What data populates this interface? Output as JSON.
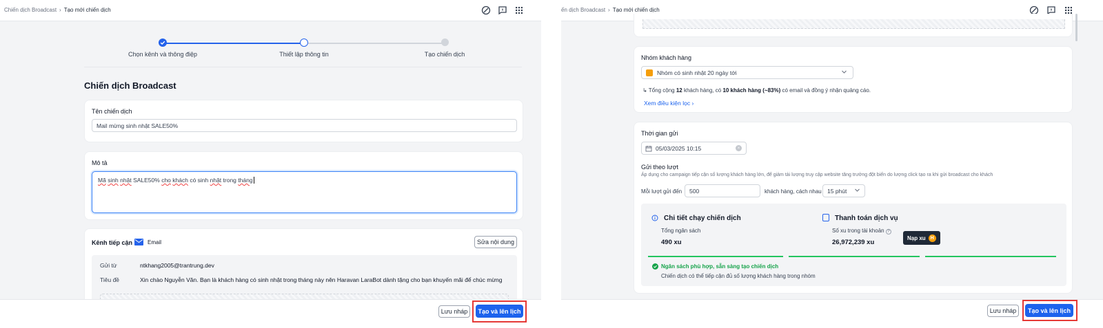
{
  "breadcrumb": {
    "parent": "Chiến dịch Broadcast",
    "separator": "›",
    "current": "Tạo mới chiến dịch"
  },
  "stepper": {
    "steps": [
      {
        "label": "Chọn kênh và thông điệp",
        "state": "done"
      },
      {
        "label": "Thiết lập thông tin",
        "state": "current"
      },
      {
        "label": "Tạo chiến dịch",
        "state": "pending"
      }
    ]
  },
  "left": {
    "page_title": "Chiến dịch Broadcast",
    "name_label": "Tên chiến dịch",
    "name_value": "Mail mừng sinh nhật SALE50%",
    "desc_label": "Mô tả",
    "desc_parts": [
      "Mã",
      " ",
      "sinh",
      " ",
      "nhật",
      " SALE50% ",
      "cho",
      " ",
      "khách",
      " có sinh ",
      "nhật",
      " trong ",
      "tháng"
    ],
    "channel_label": "Kênh tiếp cận",
    "channel_name": "Email",
    "edit_button": "Sửa nội dung",
    "from_label": "Gửi từ",
    "from_value": "ntkhang2005@trantrung.dev",
    "subject_label": "Tiêu đề",
    "subject_value": "Xin chào Nguyễn Văn. Bạn là khách hàng có sinh nhật trong tháng này nên Haravan LaraBot dành tặng cho bạn khuyến mãi để chúc mừng"
  },
  "right": {
    "segment_label": "Nhóm khách hàng",
    "segment_value": "Nhóm có sinh nhật 20 ngày tới",
    "summary_prefix": "Tổng cộng ",
    "summary_total": "12",
    "summary_mid": " khách hàng, có ",
    "summary_eligible": "10 khách hàng (~83%)",
    "summary_suffix": " có email và đồng ý nhận quảng cáo.",
    "filter_link": "Xem điều kiện lọc",
    "send_time_label": "Thời gian gửi",
    "send_time_value": "05/03/2025 10:15",
    "batch_label": "Gửi theo lượt",
    "batch_hint": "Áp dụng cho campaign tiếp cận số lượng khách hàng lớn, để giảm tải lượng truy cập website tăng trưởng đột biến do lượng click tạo ra khi gửi broadcast cho khách",
    "batch_prefix": "Mỗi lượt gửi đến",
    "batch_count": "500",
    "batch_mid": "khách hàng, cách nhau",
    "batch_interval": "15 phút",
    "detail_title": "Chi tiết chạy chiến dịch",
    "budget_label": "Tổng ngân sách",
    "budget_value": "490 xu",
    "payment_title": "Thanh toán dịch vụ",
    "balance_label": "Số xu trong tài khoản",
    "balance_value": "26,972,239 xu",
    "topup_button": "Nạp xu",
    "coin_symbol": "H",
    "status_ok": "Ngân sách phù hợp, sẵn sàng tạo chiến dịch",
    "status_detail": "Chiến dịch có thể tiếp cận đủ số lượng khách hàng trong nhóm"
  },
  "footer": {
    "draft_button": "Lưu nháp",
    "create_button": "Tạo và lên lịch"
  },
  "icons": {
    "help": "help-circle-icon",
    "feedback": "message-square-icon",
    "apps": "grid-icon"
  },
  "colors": {
    "primary": "#1d63ed",
    "success": "#22c55e",
    "highlight": "#e53935"
  }
}
